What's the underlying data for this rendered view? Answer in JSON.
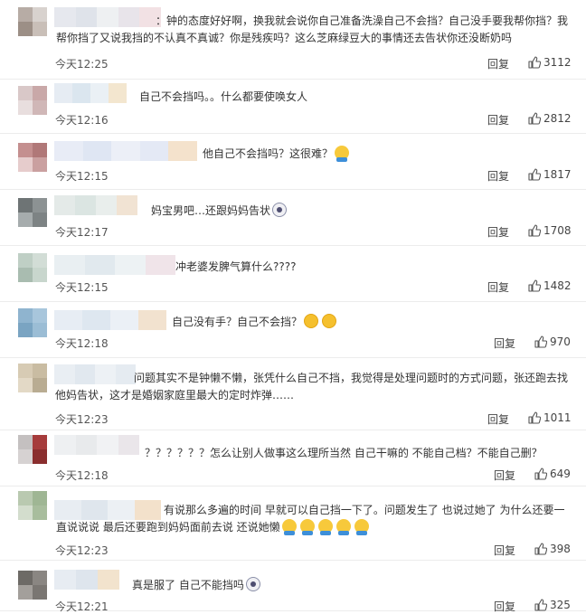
{
  "colors": {
    "text": "#333333",
    "meta": "#555555",
    "divider": "#ececec",
    "blob_emoji": "#f7c93b"
  },
  "reply_label": "回复",
  "comments": [
    {
      "lines": [
        "：钟的态度好好啊，换我就会说你自己准备洗澡自己不会挡？自己没手要我帮你挡？我",
        "帮你挡了又说我挡的不认真不真诚？你是残疾吗？这么芝麻绿豆大的事情还去告状你还没断奶吗"
      ],
      "time": "今天12:25",
      "likes": "3112",
      "avatar": [
        "#b7aca5",
        "#d8d2ce",
        "#9c8f86",
        "#c9bfb8"
      ],
      "name_blocks": [
        "#e6e8ee",
        "#dfe3ea",
        "#eef0f2",
        "#e8e4ea",
        "#f2e1e4"
      ],
      "emojis": []
    },
    {
      "lines": [
        "自己不会挡吗。。什么都要使唤女人"
      ],
      "time": "今天12:16",
      "likes": "2812",
      "avatar": [
        "#d9c8c8",
        "#c9a8a8",
        "#e8dede",
        "#d0b7b7"
      ],
      "name_blocks": [
        "#e6ecf3",
        "#dbe6ef",
        "#eaf0f5",
        "#f3e6cf"
      ],
      "emojis": []
    },
    {
      "lines": [
        "他自己不会挡吗？这很难？"
      ],
      "time": "今天12:15",
      "likes": "1817",
      "avatar": [
        "#c48f8f",
        "#b07878",
        "#e6cccc",
        "#caa0a0"
      ],
      "name_blocks": [
        "#e8ecf6",
        "#dfe6f3",
        "#eceff7",
        "#e4e9f5",
        "#f4e2cc"
      ],
      "emojis": [
        "blob"
      ]
    },
    {
      "lines": [
        "妈宝男吧…还跟妈妈告状"
      ],
      "time": "今天12:17",
      "likes": "1708",
      "avatar": [
        "#6e7475",
        "#8c9293",
        "#a6acad",
        "#7d8384"
      ],
      "name_blocks": [
        "#e4eae8",
        "#dbe5e2",
        "#e9eeec",
        "#f1e3d3"
      ],
      "emojis": [
        "cry"
      ]
    },
    {
      "lines": [
        "冲老婆发脾气算什么????"
      ],
      "time": "今天12:15",
      "likes": "1482",
      "avatar": [
        "#bfcfc5",
        "#d2ddd6",
        "#a9bcb0",
        "#c8d6cd"
      ],
      "name_blocks": [
        "#e9eff2",
        "#e1e9ee",
        "#edf2f4",
        "#f0e4e9"
      ],
      "emojis": []
    },
    {
      "lines": [
        "自己没有手？自己不会挡？"
      ],
      "time": "今天12:18",
      "likes": "970",
      "avatar": [
        "#8fb4cf",
        "#a8c6dc",
        "#7aa4c2",
        "#9bbdd5"
      ],
      "name_blocks": [
        "#e7edf4",
        "#dee7f0",
        "#ebf0f6",
        "#f2e2cf"
      ],
      "emojis": [
        "smirk",
        "smirk"
      ]
    },
    {
      "lines": [
        "问题其实不是钟懒不懒，张凭什么自己不挡，我觉得是处理问题时的方式问题，张还跑去找",
        "他妈告状，这才是婚姻家庭里最大的定时炸弹……"
      ],
      "time": "今天12:23",
      "likes": "1011",
      "avatar": [
        "#d7cbb4",
        "#c9bca2",
        "#e3d9c6",
        "#b9ac92"
      ],
      "name_blocks": [
        "#e9eef3",
        "#e1e8ef",
        "#edf1f5",
        "#e5ebf1"
      ],
      "emojis": []
    },
    {
      "lines": [
        "？？？？？？怎么让别人做事这么理所当然 自己干嘛的 不能自己档？不能自己删？"
      ],
      "time": "今天12:18",
      "likes": "649",
      "avatar": [
        "#c4c0c0",
        "#a63c3c",
        "#d6d2d2",
        "#8a2e2e"
      ],
      "name_blocks": [
        "#eef0f2",
        "#e8eaec",
        "#f1f2f4",
        "#eae6ea"
      ],
      "emojis": []
    },
    {
      "lines": [
        "有说那么多遍的时间 早就可以自己挡一下了。问题发生了 也说过她了 为什么还要一",
        "直说说说 最后还要跑到妈妈面前去说 还说她懒"
      ],
      "time": "今天12:23",
      "likes": "398",
      "avatar": [
        "#b9c9b0",
        "#9fb694",
        "#d3ddcd",
        "#a8bd9d"
      ],
      "name_blocks": [
        "#e8edf2",
        "#dfe6ed",
        "#ecf0f4",
        "#f3e1cb"
      ],
      "emojis": [
        "blob",
        "blob",
        "blob",
        "blob",
        "blob"
      ]
    },
    {
      "lines": [
        "真是服了 自己不能挡吗"
      ],
      "time": "今天12:21",
      "likes": "325",
      "avatar": [
        "#6d6a66",
        "#8a8682",
        "#a39f9b",
        "#7a7672"
      ],
      "name_blocks": [
        "#e7ecf2",
        "#dee5ed",
        "#f2e3cd"
      ],
      "emojis": [
        "cry"
      ]
    }
  ]
}
